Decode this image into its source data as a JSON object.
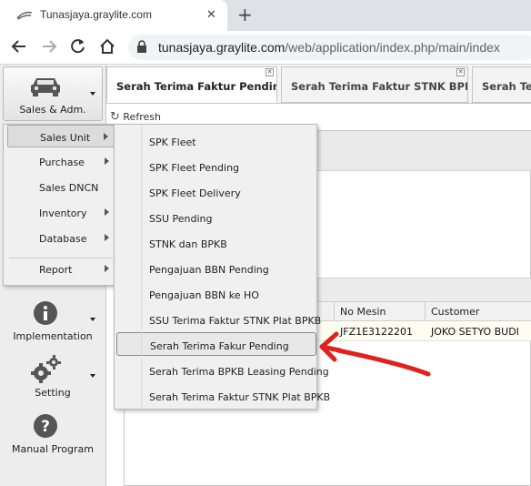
{
  "browser": {
    "tab_title": "Tunasjaya.graylite.com",
    "url_host": "tunasjaya.graylite.com",
    "url_path": "/web/application/index.php/main/index",
    "icons": [
      "graylite-logo-icon",
      "close-icon",
      "new-tab-icon",
      "back-icon",
      "forward-icon",
      "reload-icon",
      "home-icon",
      "lock-icon"
    ]
  },
  "app_tabs": [
    {
      "label": "Serah Terima Faktur Pending",
      "active": true
    },
    {
      "label": "Serah Terima Faktur STNK BPKB",
      "active": false
    },
    {
      "label": "Serah Teri",
      "active": false
    }
  ],
  "toolbar": {
    "refresh_label": "Refresh"
  },
  "nav": [
    {
      "label": "Sales & Adm.",
      "icon": "car-icon"
    },
    {
      "label": "Implementation",
      "icon": "info-icon"
    },
    {
      "label": "Setting",
      "icon": "gears-icon"
    },
    {
      "label": "Manual Program",
      "icon": "help-icon"
    }
  ],
  "menu_level1": [
    {
      "label": "Sales Unit",
      "submenu": true
    },
    {
      "label": "Purchase",
      "submenu": true
    },
    {
      "label": "Sales DNCN",
      "submenu": false
    },
    {
      "label": "Inventory",
      "submenu": true
    },
    {
      "label": "Database",
      "submenu": true
    },
    {
      "label": "Report",
      "submenu": true
    }
  ],
  "menu_level2": [
    "SPK Fleet",
    "SPK Fleet Pending",
    "SPK Fleet Delivery",
    "SSU Pending",
    "STNK dan BPKB",
    "Pengajuan BBN Pending",
    "Pengajuan BBN ke HO",
    "SSU Terima Faktur STNK Plat BPKB",
    "Serah Terima Fakur Pending",
    "Serah Terima BPKB Leasing Pending",
    "Serah Terima Faktur STNK Plat BPKB"
  ],
  "grid": {
    "columns": [
      "No Mesin",
      "Customer"
    ],
    "rows": [
      [
        "JFZ1E3122201",
        "JOKO SETYO BUDI"
      ]
    ]
  },
  "colors": {
    "annotation_arrow": "#e0211d"
  }
}
